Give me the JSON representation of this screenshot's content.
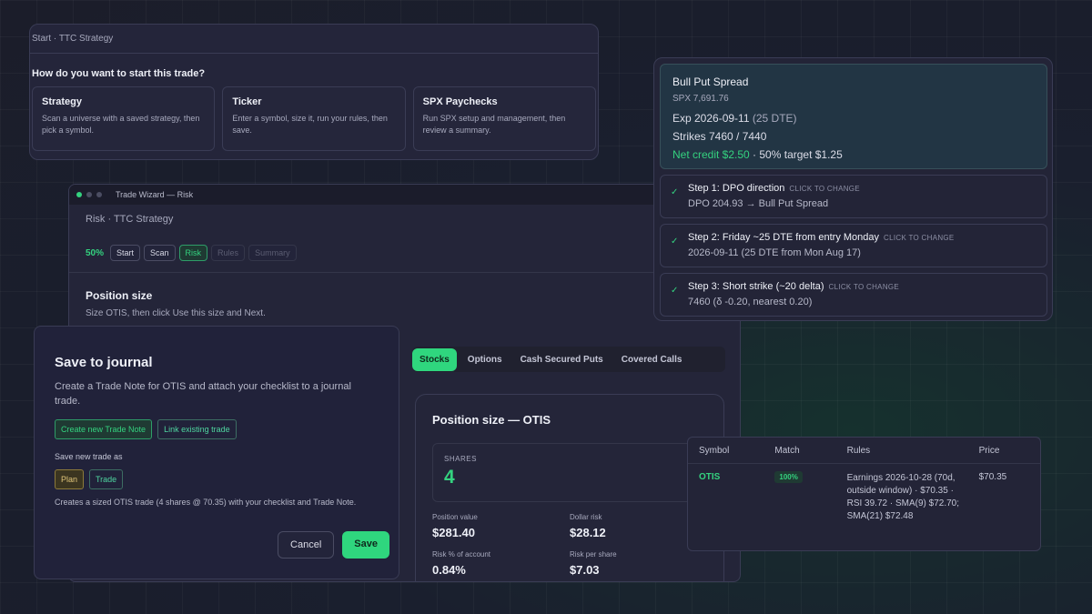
{
  "start": {
    "breadcrumb": "Start · TTC Strategy",
    "question": "How do you want to start this trade?",
    "options": [
      {
        "title": "Strategy",
        "desc": "Scan a universe with a saved strategy, then pick a symbol."
      },
      {
        "title": "Ticker",
        "desc": "Enter a symbol, size it, run your rules, then save."
      },
      {
        "title": "SPX Paychecks",
        "desc": "Run SPX setup and management, then review a summary."
      }
    ]
  },
  "wizard": {
    "window_title": "Trade Wizard — Risk",
    "breadcrumb": "Risk · TTC Strategy",
    "progress": "50%",
    "steps": [
      "Start",
      "Scan",
      "Risk",
      "Rules",
      "Summary"
    ],
    "section_title": "Position size",
    "section_sub": "Size OTIS, then click Use this size and Next.",
    "tabs": [
      "Stocks",
      "Options",
      "Cash Secured Puts",
      "Covered Calls"
    ],
    "position": {
      "title": "Position size — OTIS",
      "shares_label": "SHARES",
      "shares": "4",
      "stats": [
        {
          "label": "Position value",
          "value": "$281.40"
        },
        {
          "label": "Dollar risk",
          "value": "$28.12"
        },
        {
          "label": "Risk % of account",
          "value": "0.84%"
        },
        {
          "label": "Risk per share",
          "value": "$7.03"
        }
      ]
    }
  },
  "spread": {
    "title": "Bull Put Spread",
    "spx": "SPX 7,691.76",
    "exp": "Exp 2026-09-11",
    "dte": "(25 DTE)",
    "strikes": "Strikes 7460 / 7440",
    "credit": "Net credit $2.50",
    "target": " · 50% target $1.25",
    "click_label": "CLICK TO CHANGE",
    "steps": [
      {
        "title": "Step 1: DPO direction",
        "detail": "DPO 204.93 → Bull Put Spread"
      },
      {
        "title": "Step 2: Friday ~25 DTE from entry Monday",
        "detail": "2026-09-11 (25 DTE from Mon Aug 17)"
      },
      {
        "title": "Step 3: Short strike (~20 delta)",
        "detail": "7460 (δ -0.20, nearest 0.20)"
      }
    ]
  },
  "journal": {
    "title": "Save to journal",
    "desc": "Create a Trade Note for OTIS and attach your checklist to a journal trade.",
    "create_btn": "Create new Trade Note",
    "link_btn": "Link existing trade",
    "save_as_label": "Save new trade as",
    "plan_btn": "Plan",
    "trade_btn": "Trade",
    "note": "Creates a sized OTIS trade (4 shares @ 70.35) with your checklist and Trade Note.",
    "cancel": "Cancel",
    "save": "Save"
  },
  "table": {
    "headers": [
      "Symbol",
      "Match",
      "Rules",
      "Price"
    ],
    "row": {
      "symbol": "OTIS",
      "match": "100%",
      "rules": "Earnings 2026-10-28 (70d, outside window) · $70.35 · RSI 39.72 · SMA(9) $72.70; SMA(21) $72.48",
      "price": "$70.35"
    }
  }
}
